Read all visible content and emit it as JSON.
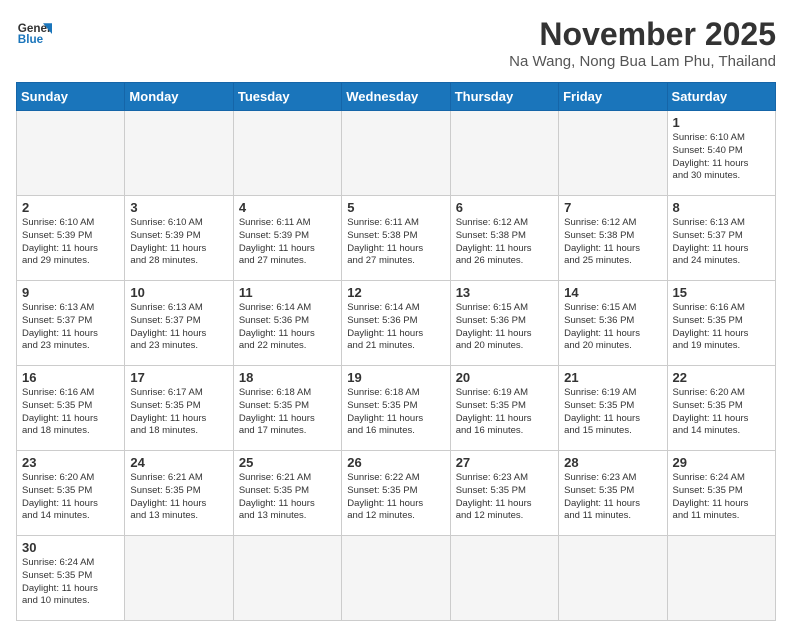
{
  "logo": {
    "line1": "General",
    "line2": "Blue"
  },
  "title": "November 2025",
  "location": "Na Wang, Nong Bua Lam Phu, Thailand",
  "weekdays": [
    "Sunday",
    "Monday",
    "Tuesday",
    "Wednesday",
    "Thursday",
    "Friday",
    "Saturday"
  ],
  "days": [
    {
      "date": null
    },
    {
      "date": null
    },
    {
      "date": null
    },
    {
      "date": null
    },
    {
      "date": null
    },
    {
      "date": null
    },
    {
      "date": "1",
      "sunrise": "6:10 AM",
      "sunset": "5:40 PM",
      "daylight_hours": "11 hours",
      "daylight_minutes": "and 30 minutes."
    },
    {
      "date": "2",
      "sunrise": "6:10 AM",
      "sunset": "5:39 PM",
      "daylight_hours": "11 hours",
      "daylight_minutes": "and 29 minutes."
    },
    {
      "date": "3",
      "sunrise": "6:10 AM",
      "sunset": "5:39 PM",
      "daylight_hours": "11 hours",
      "daylight_minutes": "and 28 minutes."
    },
    {
      "date": "4",
      "sunrise": "6:11 AM",
      "sunset": "5:39 PM",
      "daylight_hours": "11 hours",
      "daylight_minutes": "and 27 minutes."
    },
    {
      "date": "5",
      "sunrise": "6:11 AM",
      "sunset": "5:38 PM",
      "daylight_hours": "11 hours",
      "daylight_minutes": "and 27 minutes."
    },
    {
      "date": "6",
      "sunrise": "6:12 AM",
      "sunset": "5:38 PM",
      "daylight_hours": "11 hours",
      "daylight_minutes": "and 26 minutes."
    },
    {
      "date": "7",
      "sunrise": "6:12 AM",
      "sunset": "5:38 PM",
      "daylight_hours": "11 hours",
      "daylight_minutes": "and 25 minutes."
    },
    {
      "date": "8",
      "sunrise": "6:13 AM",
      "sunset": "5:37 PM",
      "daylight_hours": "11 hours",
      "daylight_minutes": "and 24 minutes."
    },
    {
      "date": "9",
      "sunrise": "6:13 AM",
      "sunset": "5:37 PM",
      "daylight_hours": "11 hours",
      "daylight_minutes": "and 23 minutes."
    },
    {
      "date": "10",
      "sunrise": "6:13 AM",
      "sunset": "5:37 PM",
      "daylight_hours": "11 hours",
      "daylight_minutes": "and 23 minutes."
    },
    {
      "date": "11",
      "sunrise": "6:14 AM",
      "sunset": "5:36 PM",
      "daylight_hours": "11 hours",
      "daylight_minutes": "and 22 minutes."
    },
    {
      "date": "12",
      "sunrise": "6:14 AM",
      "sunset": "5:36 PM",
      "daylight_hours": "11 hours",
      "daylight_minutes": "and 21 minutes."
    },
    {
      "date": "13",
      "sunrise": "6:15 AM",
      "sunset": "5:36 PM",
      "daylight_hours": "11 hours",
      "daylight_minutes": "and 20 minutes."
    },
    {
      "date": "14",
      "sunrise": "6:15 AM",
      "sunset": "5:36 PM",
      "daylight_hours": "11 hours",
      "daylight_minutes": "and 20 minutes."
    },
    {
      "date": "15",
      "sunrise": "6:16 AM",
      "sunset": "5:35 PM",
      "daylight_hours": "11 hours",
      "daylight_minutes": "and 19 minutes."
    },
    {
      "date": "16",
      "sunrise": "6:16 AM",
      "sunset": "5:35 PM",
      "daylight_hours": "11 hours",
      "daylight_minutes": "and 18 minutes."
    },
    {
      "date": "17",
      "sunrise": "6:17 AM",
      "sunset": "5:35 PM",
      "daylight_hours": "11 hours",
      "daylight_minutes": "and 18 minutes."
    },
    {
      "date": "18",
      "sunrise": "6:18 AM",
      "sunset": "5:35 PM",
      "daylight_hours": "11 hours",
      "daylight_minutes": "and 17 minutes."
    },
    {
      "date": "19",
      "sunrise": "6:18 AM",
      "sunset": "5:35 PM",
      "daylight_hours": "11 hours",
      "daylight_minutes": "and 16 minutes."
    },
    {
      "date": "20",
      "sunrise": "6:19 AM",
      "sunset": "5:35 PM",
      "daylight_hours": "11 hours",
      "daylight_minutes": "and 16 minutes."
    },
    {
      "date": "21",
      "sunrise": "6:19 AM",
      "sunset": "5:35 PM",
      "daylight_hours": "11 hours",
      "daylight_minutes": "and 15 minutes."
    },
    {
      "date": "22",
      "sunrise": "6:20 AM",
      "sunset": "5:35 PM",
      "daylight_hours": "11 hours",
      "daylight_minutes": "and 14 minutes."
    },
    {
      "date": "23",
      "sunrise": "6:20 AM",
      "sunset": "5:35 PM",
      "daylight_hours": "11 hours",
      "daylight_minutes": "and 14 minutes."
    },
    {
      "date": "24",
      "sunrise": "6:21 AM",
      "sunset": "5:35 PM",
      "daylight_hours": "11 hours",
      "daylight_minutes": "and 13 minutes."
    },
    {
      "date": "25",
      "sunrise": "6:21 AM",
      "sunset": "5:35 PM",
      "daylight_hours": "11 hours",
      "daylight_minutes": "and 13 minutes."
    },
    {
      "date": "26",
      "sunrise": "6:22 AM",
      "sunset": "5:35 PM",
      "daylight_hours": "11 hours",
      "daylight_minutes": "and 12 minutes."
    },
    {
      "date": "27",
      "sunrise": "6:23 AM",
      "sunset": "5:35 PM",
      "daylight_hours": "11 hours",
      "daylight_minutes": "and 12 minutes."
    },
    {
      "date": "28",
      "sunrise": "6:23 AM",
      "sunset": "5:35 PM",
      "daylight_hours": "11 hours",
      "daylight_minutes": "and 11 minutes."
    },
    {
      "date": "29",
      "sunrise": "6:24 AM",
      "sunset": "5:35 PM",
      "daylight_hours": "11 hours",
      "daylight_minutes": "and 11 minutes."
    },
    {
      "date": "30",
      "sunrise": "6:24 AM",
      "sunset": "5:35 PM",
      "daylight_hours": "11 hours",
      "daylight_minutes": "and 10 minutes."
    },
    {
      "date": null
    },
    {
      "date": null
    },
    {
      "date": null
    },
    {
      "date": null
    },
    {
      "date": null
    },
    {
      "date": null
    }
  ]
}
